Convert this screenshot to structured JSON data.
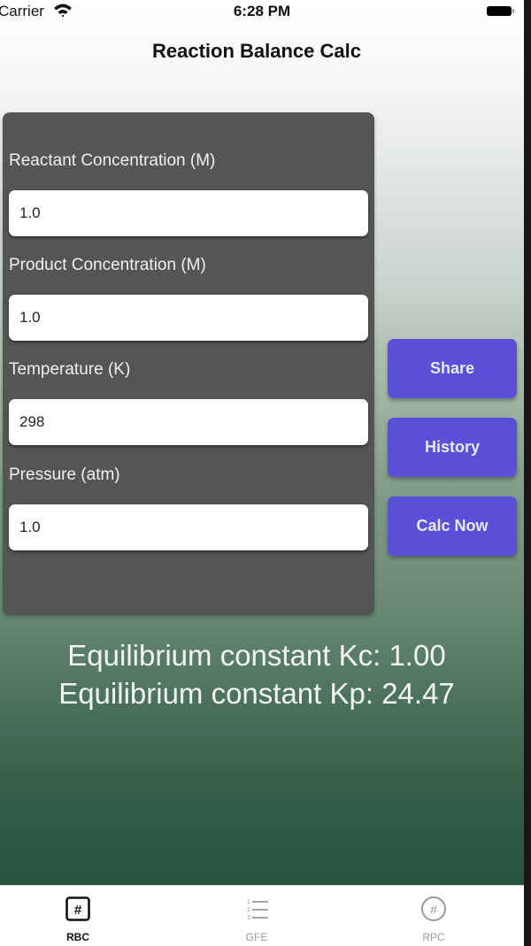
{
  "status_bar": {
    "carrier": "Carrier",
    "time": "6:28 PM",
    "wifi_icon": "wifi-icon",
    "battery_icon": "battery-icon"
  },
  "header": {
    "title": "Reaction Balance Calc"
  },
  "form": {
    "fields": [
      {
        "label": "Reactant Concentration (M)",
        "value": "1.0"
      },
      {
        "label": "Product Concentration (M)",
        "value": "1.0"
      },
      {
        "label": "Temperature (K)",
        "value": "298"
      },
      {
        "label": "Pressure (atm)",
        "value": "1.0"
      }
    ]
  },
  "actions": {
    "share": "Share",
    "history": "History",
    "calc": "Calc Now"
  },
  "results": {
    "kc": "Equilibrium constant Kc: 1.00",
    "kp": "Equilibrium constant Kp: 24.47"
  },
  "tabs": [
    {
      "label": "RBC",
      "icon": "hash-square-icon",
      "active": true
    },
    {
      "label": "GFE",
      "icon": "numbered-list-icon",
      "active": false
    },
    {
      "label": "RPC",
      "icon": "hash-circle-icon",
      "active": false
    }
  ],
  "colors": {
    "accent": "#5a51d8",
    "panel": "#555555",
    "active_tab": "#111111",
    "inactive_tab": "#9a9a9a"
  }
}
